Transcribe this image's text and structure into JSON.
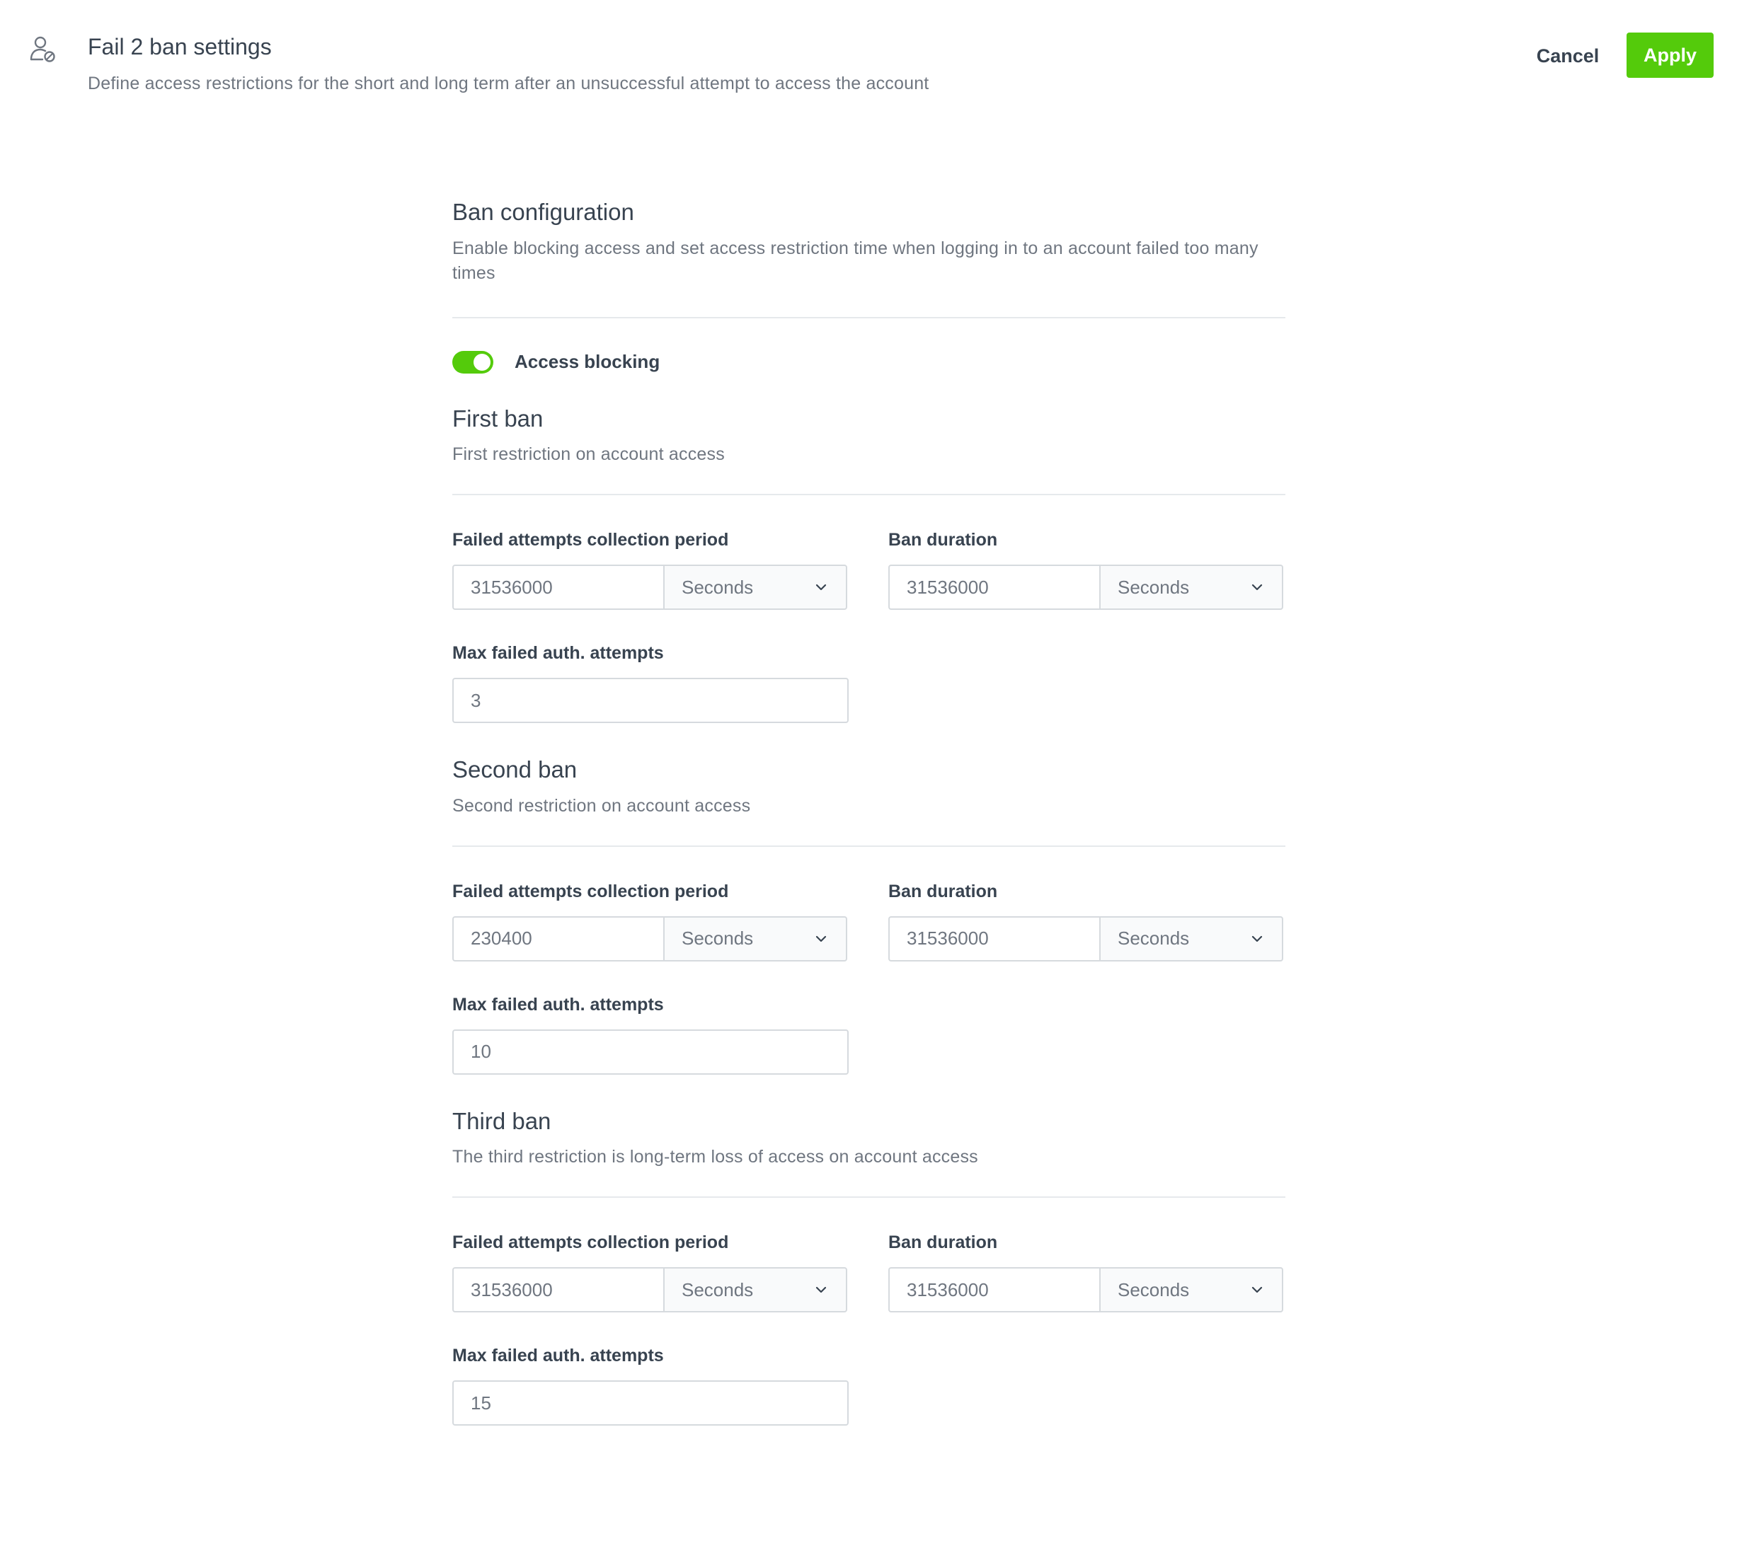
{
  "header": {
    "title": "Fail 2 ban settings",
    "subtitle": "Define access restrictions for the short and long term after an unsuccessful attempt to access the account",
    "icon": "user-settings-icon",
    "cancel_label": "Cancel",
    "apply_label": "Apply"
  },
  "config": {
    "title": "Ban configuration",
    "description": "Enable blocking access and set access restriction time when logging in to an account failed too many times",
    "toggle_label": "Access blocking",
    "toggle_on": true
  },
  "colors": {
    "accent": "#54cb0b",
    "text": "#384350",
    "muted": "#6f7680",
    "border": "#d6dade"
  },
  "labels": {
    "period": "Failed attempts collection period",
    "duration": "Ban duration",
    "max_attempts": "Max failed auth. attempts"
  },
  "bans": [
    {
      "title": "First ban",
      "description": "First restriction on account access",
      "period_value": "31536000",
      "period_unit": "Seconds",
      "duration_value": "31536000",
      "duration_unit": "Seconds",
      "max_attempts": "3"
    },
    {
      "title": "Second ban",
      "description": "Second restriction on account access",
      "period_value": "230400",
      "period_unit": "Seconds",
      "duration_value": "31536000",
      "duration_unit": "Seconds",
      "max_attempts": "10"
    },
    {
      "title": "Third ban",
      "description": "The third restriction is long-term loss of access on account access",
      "period_value": "31536000",
      "period_unit": "Seconds",
      "duration_value": "31536000",
      "duration_unit": "Seconds",
      "max_attempts": "15"
    }
  ]
}
